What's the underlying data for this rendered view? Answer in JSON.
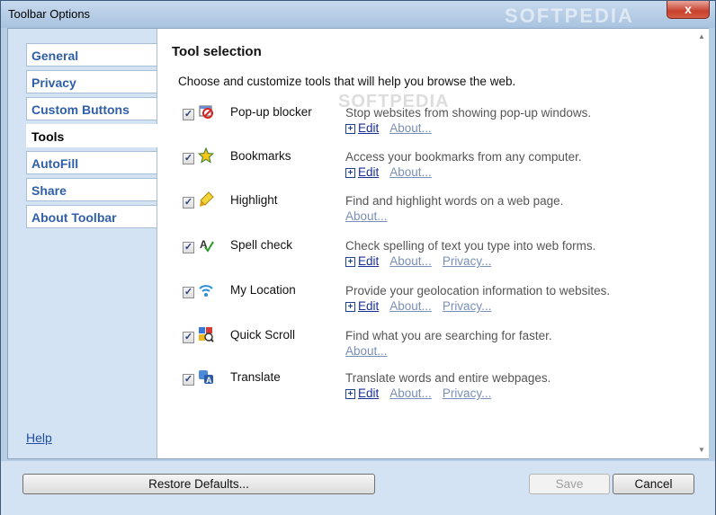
{
  "window": {
    "title": "Toolbar Options",
    "watermark": "SOFTPEDIA",
    "close_glyph": "x"
  },
  "sidebar": {
    "items": [
      {
        "label": "General"
      },
      {
        "label": "Privacy"
      },
      {
        "label": "Custom Buttons"
      },
      {
        "label": "Tools",
        "active": true
      },
      {
        "label": "AutoFill"
      },
      {
        "label": "Share"
      },
      {
        "label": "About Toolbar"
      }
    ],
    "help_label": "Help"
  },
  "main": {
    "title": "Tool selection",
    "description": "Choose and customize tools that will help you browse the web.",
    "watermark": "SOFTPEDIA",
    "edit_label": "Edit",
    "about_label": "About...",
    "privacy_label": "Privacy...",
    "tools": [
      {
        "name": "Pop-up blocker",
        "description": "Stop websites from showing pop-up windows.",
        "checked": true,
        "icon": "popup-blocker-icon",
        "links": [
          "edit",
          "about"
        ]
      },
      {
        "name": "Bookmarks",
        "description": "Access your bookmarks from any computer.",
        "checked": true,
        "icon": "star-icon",
        "links": [
          "edit",
          "about"
        ]
      },
      {
        "name": "Highlight",
        "description": "Find and highlight words on a web page.",
        "checked": true,
        "icon": "highlighter-icon",
        "links": [
          "about"
        ]
      },
      {
        "name": "Spell check",
        "description": "Check spelling of text you type into web forms.",
        "checked": true,
        "icon": "spellcheck-icon",
        "links": [
          "edit",
          "about",
          "privacy"
        ]
      },
      {
        "name": "My Location",
        "description": "Provide your geolocation information to websites.",
        "checked": true,
        "icon": "location-signal-icon",
        "links": [
          "edit",
          "about",
          "privacy"
        ]
      },
      {
        "name": "Quick Scroll",
        "description": "Find what you are searching for faster.",
        "checked": true,
        "icon": "quick-scroll-icon",
        "links": [
          "about"
        ]
      },
      {
        "name": "Translate",
        "description": "Translate words and entire webpages.",
        "checked": true,
        "icon": "translate-icon",
        "links": [
          "edit",
          "about",
          "privacy"
        ]
      }
    ]
  },
  "footer": {
    "restore_label": "Restore Defaults...",
    "save_label": "Save",
    "cancel_label": "Cancel"
  }
}
